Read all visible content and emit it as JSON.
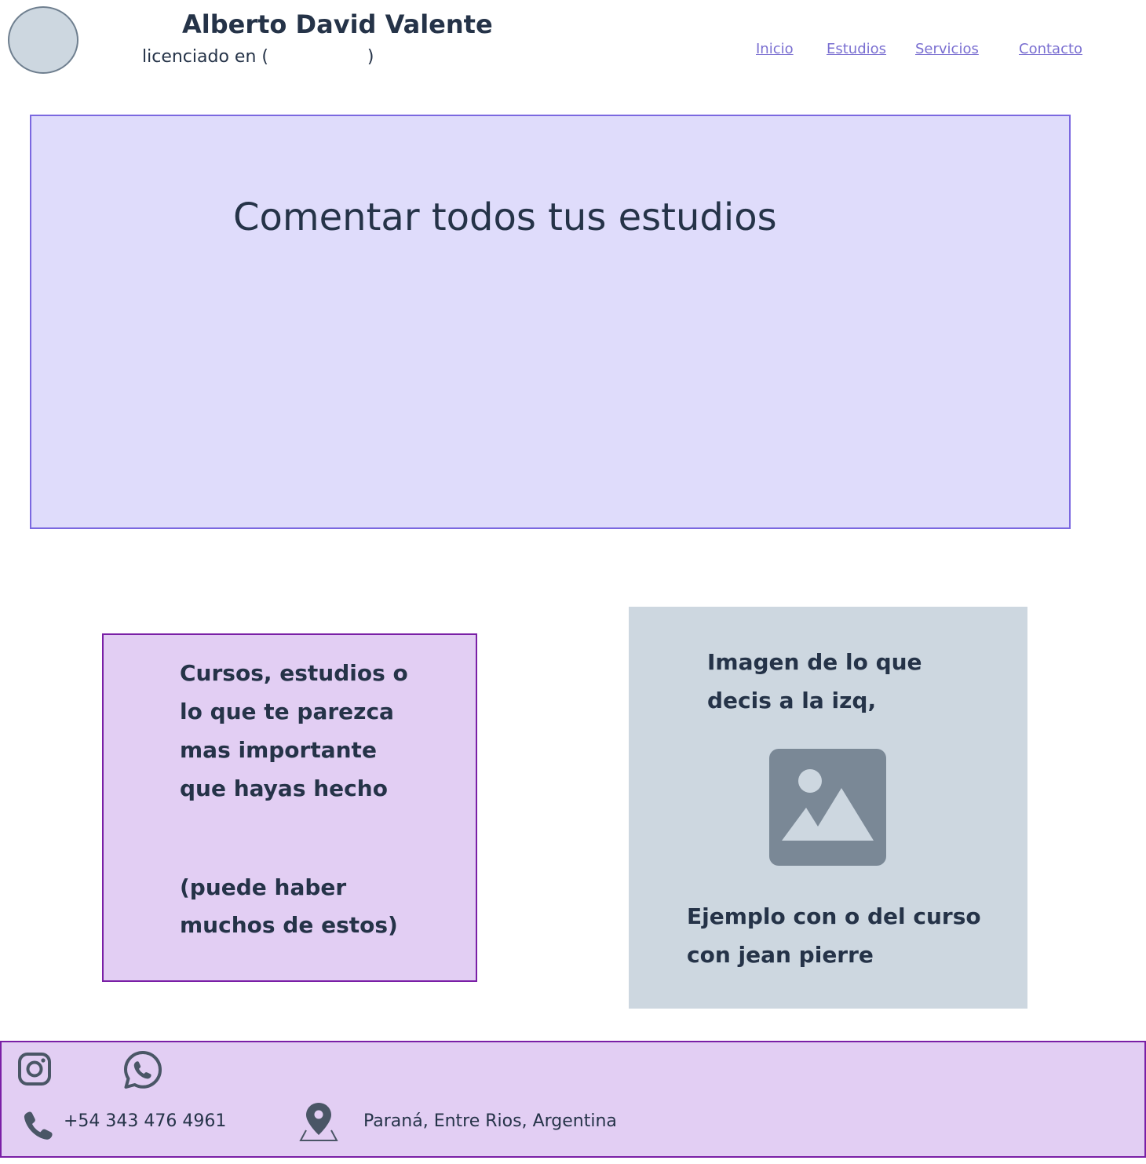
{
  "header": {
    "name": "Alberto David Valente",
    "subtitle": "licenciado en (                  )",
    "nav": [
      "Inicio",
      "Estudios",
      "Servicios",
      "Contacto"
    ]
  },
  "hero": {
    "title": "Comentar todos tus estudios"
  },
  "study_card": {
    "text": "Cursos, estudios o lo que te parezca mas importante que hayas hecho",
    "note": "(puede haber muchos de estos)"
  },
  "image_card": {
    "caption_top": "Imagen de lo que decis a la izq,",
    "caption_bottom": "Ejemplo con o del curso con jean pierre",
    "icon": "image-placeholder-icon"
  },
  "footer": {
    "phone": "+54 343 476 4961",
    "location": "Paraná, Entre Rios, Argentina",
    "icons": [
      "instagram-icon",
      "whatsapp-icon",
      "phone-icon",
      "location-pin-icon"
    ]
  },
  "colors": {
    "hero_bg": "#dfdcfb",
    "hero_border": "#7b68e0",
    "card_bg": "#e2cef3",
    "card_border": "#7a1fa6",
    "image_card_bg": "#cdd7e0",
    "nav_link": "#7a6fd1",
    "text": "#253348"
  }
}
